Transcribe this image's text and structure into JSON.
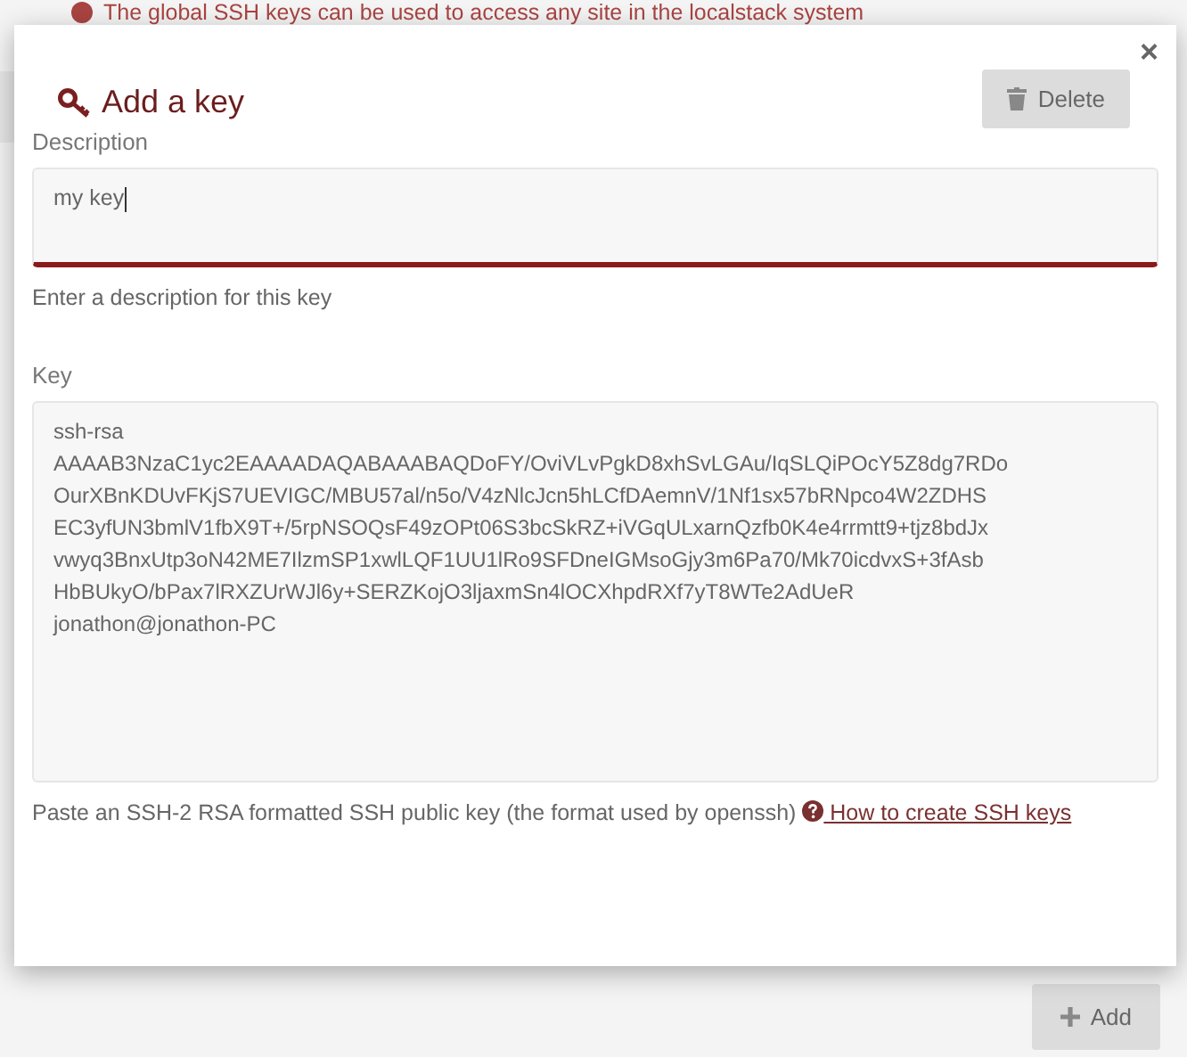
{
  "background_notice": {
    "text": "The global SSH keys can be used to access any site in the localstack system"
  },
  "dialog": {
    "title": "Add a key",
    "close": "×",
    "delete_button": "Delete",
    "fields": [
      {
        "label": "Description",
        "value": "my key",
        "focused": true,
        "help": "Enter a description for this key"
      },
      {
        "label": "Key",
        "value": "ssh-rsa\nAAAAB3NzaC1yc2EAAAADAQABAAABAQDoFY/OviVLvPgkD8xhSvLGAu/IqSLQiPOcY5Z8dg7RDo\nOurXBnKDUvFKjS7UEVIGC/MBU57al/n5o/V4zNlcJcn5hLCfDAemnV/1Nf1sx57bRNpco4W2ZDHS\nEC3yfUN3bmlV1fbX9T+/5rpNSOQsF49zOPt06S3bcSkRZ+iVGqULxarnQzfb0K4e4rrmtt9+tjz8bdJx\nvwyq3BnxUtp3oN42ME7IlzmSP1xwlLQF1UU1lRo9SFDneIGMsoGjy3m6Pa70/Mk70icdvxS+3fAsb\nHbBUkyO/bPax7lRXZUrWJl6y+SERZKojO3ljaxmSn4lOCXhpdRXf7yT8WTe2AdUeR\njonathon@jonathon-PC",
        "focused": false,
        "help": "Paste an SSH-2 RSA formatted SSH public key (the format used by openssh)",
        "link": "How to create SSH keys"
      }
    ]
  },
  "add_button": "Add"
}
